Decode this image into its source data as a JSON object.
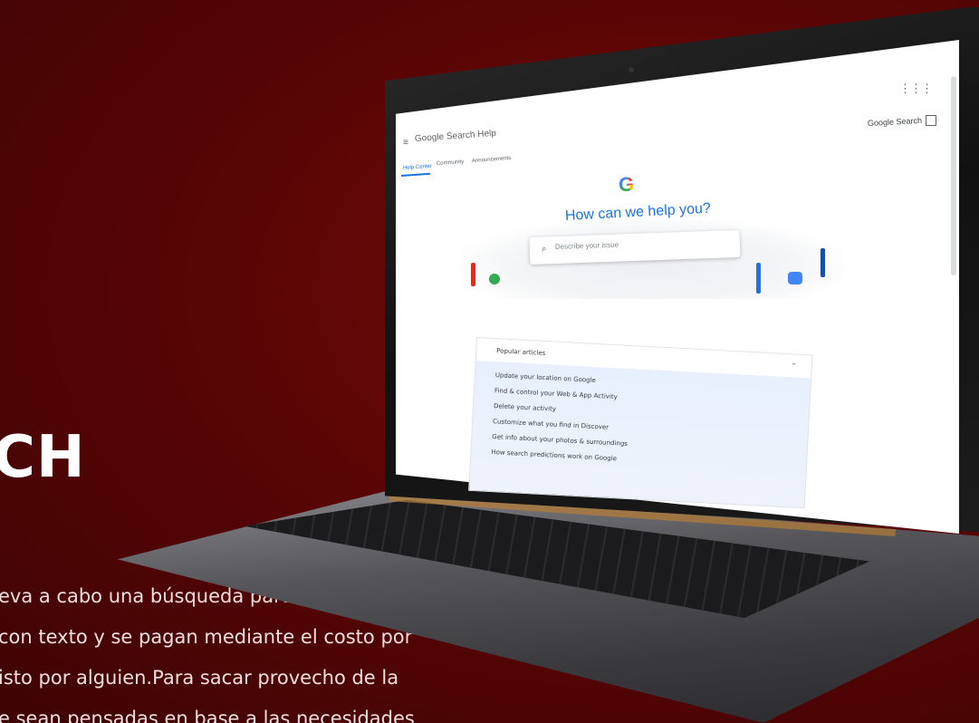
{
  "background": {
    "color": "#5a0505"
  },
  "headline": "CH",
  "paragraph": [
    "eva a cabo una búsqueda particular en",
    "con texto y se pagan mediante el costo por",
    "isto por alguien.Para sacar provecho de la",
    "e sean pensadas en base a las necesidades"
  ],
  "screen": {
    "header": {
      "menu_icon": "≡",
      "title": "Google Search Help",
      "apps_icon": "⋮⋮⋮",
      "product_link": "Google Search"
    },
    "tabs": [
      {
        "label": "Help Center",
        "active": true
      },
      {
        "label": "Community",
        "active": false
      },
      {
        "label": "Announcements",
        "active": false
      }
    ],
    "hero": {
      "logo": "G",
      "title": "How can we help you?",
      "search_placeholder": "Describe your issue"
    },
    "popular_articles": {
      "header": "Popular articles",
      "items": [
        "Update your location on Google",
        "Find & control your Web & App Activity",
        "Delete your activity",
        "Customize what you find in Discover",
        "Get info about your photos & surroundings",
        "How search predictions work on Google"
      ]
    }
  },
  "colors": {
    "accent": "#1a73e8",
    "laptop_hinge": "#b77e35"
  }
}
